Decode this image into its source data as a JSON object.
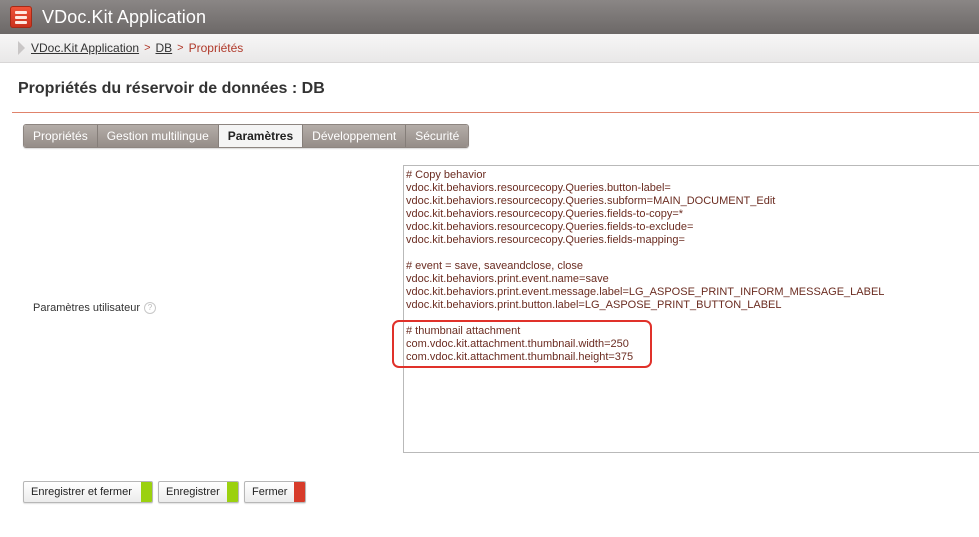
{
  "app": {
    "title": "VDoc.Kit Application",
    "logo_icon": "vdoc-logo-icon"
  },
  "breadcrumb": {
    "items": [
      {
        "label": "VDoc.Kit Application"
      },
      {
        "label": "DB"
      },
      {
        "label": "Propriétés"
      }
    ],
    "separator": ">"
  },
  "page": {
    "title": "Propriétés du réservoir de données : DB"
  },
  "tabs": [
    {
      "label": "Propriétés"
    },
    {
      "label": "Gestion multilingue"
    },
    {
      "label": "Paramètres"
    },
    {
      "label": "Développement"
    },
    {
      "label": "Sécurité"
    }
  ],
  "active_tab": "Paramètres",
  "field": {
    "label": "Paramètres utilisateur",
    "help": "?"
  },
  "textarea_lines": [
    "# Copy behavior",
    "vdoc.kit.behaviors.resourcecopy.Queries.button-label=",
    "vdoc.kit.behaviors.resourcecopy.Queries.subform=MAIN_DOCUMENT_Edit",
    "vdoc.kit.behaviors.resourcecopy.Queries.fields-to-copy=*",
    "vdoc.kit.behaviors.resourcecopy.Queries.fields-to-exclude=",
    "vdoc.kit.behaviors.resourcecopy.Queries.fields-mapping=",
    "",
    "# event = save, saveandclose, close",
    "vdoc.kit.behaviors.print.event.name=save",
    "vdoc.kit.behaviors.print.event.message.label=LG_ASPOSE_PRINT_INFORM_MESSAGE_LABEL",
    "vdoc.kit.behaviors.print.button.label=LG_ASPOSE_PRINT_BUTTON_LABEL",
    "",
    "# thumbnail attachment",
    "com.vdoc.kit.attachment.thumbnail.width=250",
    "com.vdoc.kit.attachment.thumbnail.height=375"
  ],
  "buttons": [
    {
      "label": "Enregistrer et fermer",
      "color": "#9bd10f"
    },
    {
      "label": "Enregistrer",
      "color": "#9bd10f"
    },
    {
      "label": "Fermer",
      "color": "#d73b2a"
    }
  ],
  "colors": {
    "accent": "#b0392a",
    "highlight": "#e0312a"
  }
}
